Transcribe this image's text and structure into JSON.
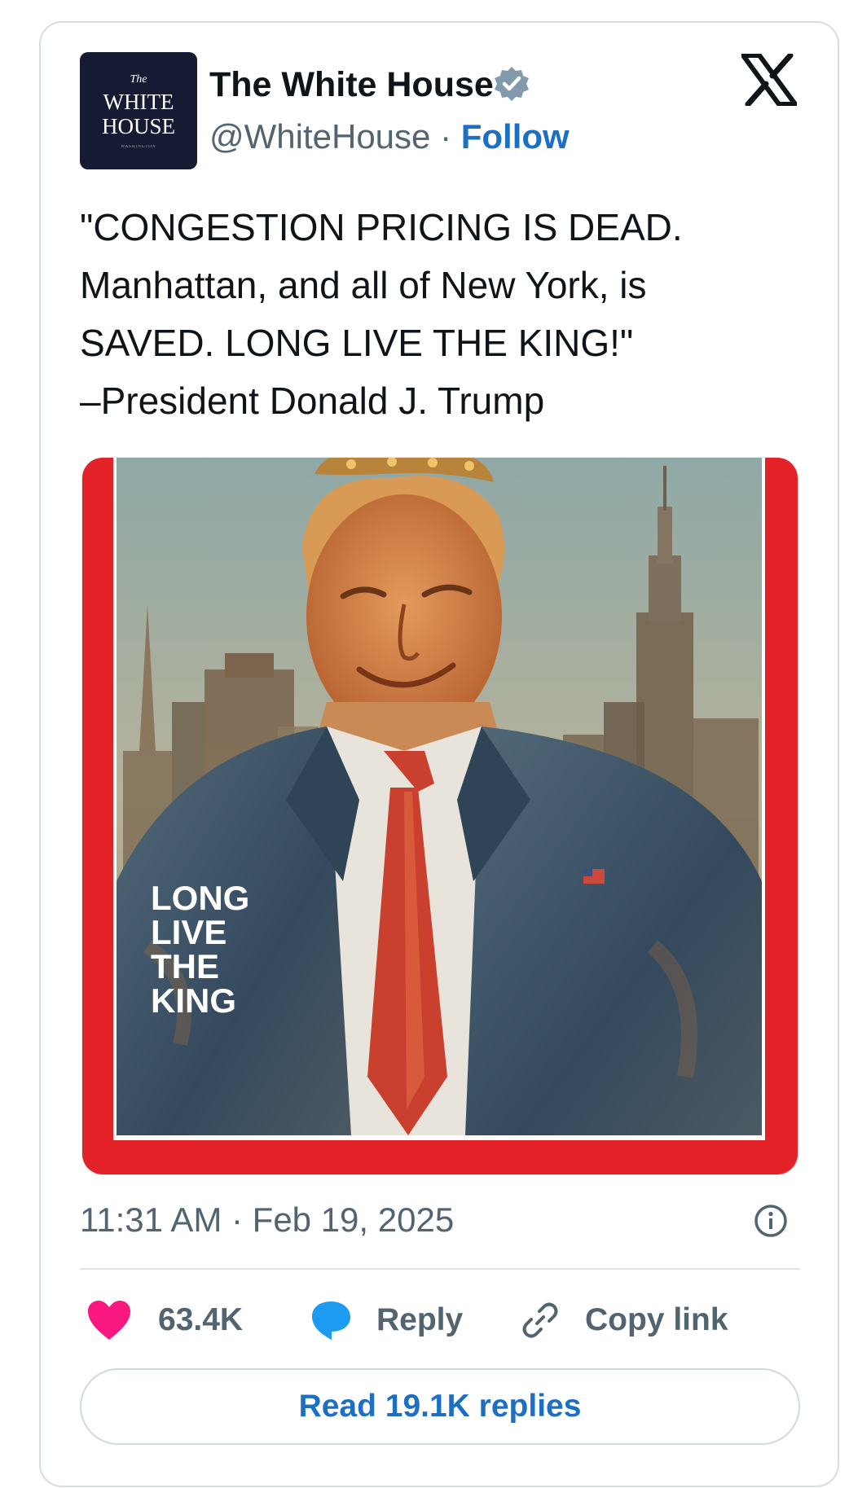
{
  "account": {
    "display_name": "The White House",
    "handle": "@WhiteHouse",
    "separator": "·",
    "follow_label": "Follow",
    "verified_icon": "verified-badge-icon",
    "avatar": {
      "line1": "The",
      "line2": "WHITE",
      "line3": "HOUSE",
      "line4": "WASHINGTON"
    }
  },
  "brand": {
    "logo_icon": "x-logo-icon"
  },
  "tweet": {
    "lines": [
      "\"CONGESTION PRICING IS DEAD.",
      "Manhattan, and all of New York, is",
      "SAVED. LONG LIVE THE KING!\"",
      "–President Donald J. Trump"
    ]
  },
  "media": {
    "cover_text": [
      "LONG",
      "LIVE",
      "THE",
      "KING"
    ],
    "colors": {
      "frame": "#e32227",
      "sky": "#9fb1ad",
      "suit": "#3f5870",
      "tie": "#c9402e"
    }
  },
  "meta": {
    "timestamp": "11:31 AM · Feb 19, 2025",
    "info_icon": "info-icon"
  },
  "actions": {
    "like_count": "63.4K",
    "like_icon": "heart-icon",
    "reply_label": "Reply",
    "reply_icon": "speech-bubble-icon",
    "copy_label": "Copy link",
    "copy_icon": "link-icon"
  },
  "replies_button": "Read 19.1K replies",
  "colors": {
    "accent": "#1d6fc4",
    "heart": "#f91880",
    "reply_blue": "#1d9bf0",
    "muted": "#536471"
  }
}
